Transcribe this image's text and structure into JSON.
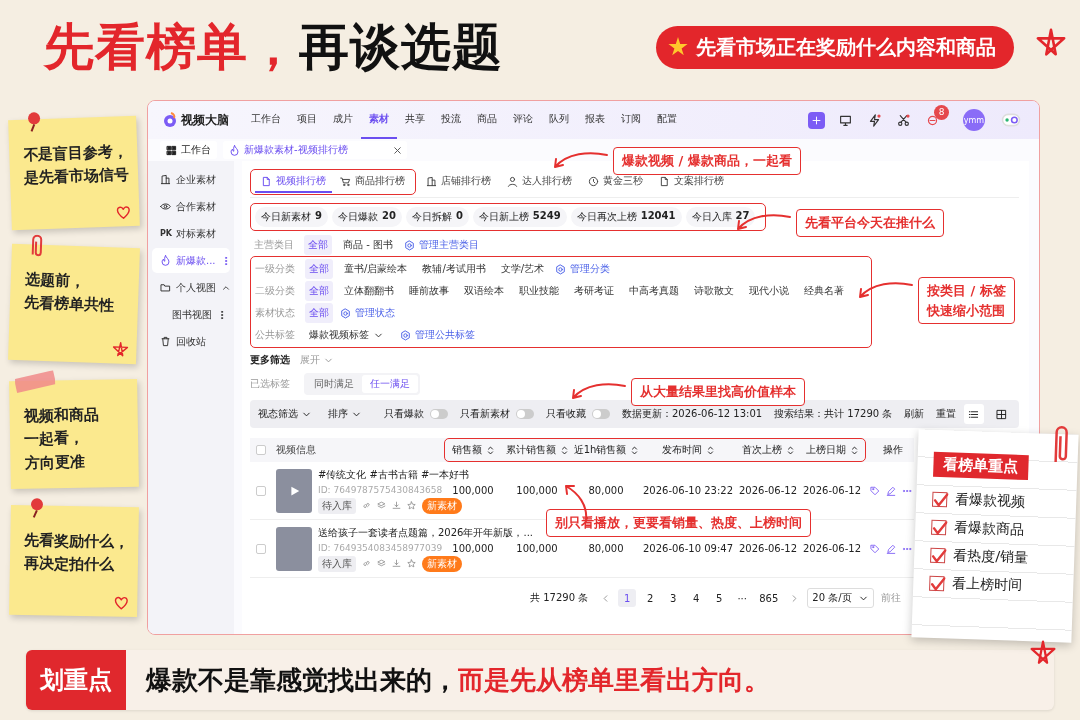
{
  "headline": {
    "parts": [
      {
        "text": "先看榜单，",
        "emphasis": true
      },
      {
        "text": "再谈选题",
        "emphasis": false
      }
    ],
    "tagline": "先看市场正在奖励什么内容和商品"
  },
  "notes": [
    {
      "lines": [
        "不是盲目参考，",
        "是先看市场信号"
      ]
    },
    {
      "lines": [
        "选题前，",
        "先看榜单共性"
      ]
    },
    {
      "lines": [
        "视频和商品",
        "一起看，",
        "方向更准"
      ]
    },
    {
      "lines": [
        "先看奖励什么，",
        "再决定拍什么"
      ]
    }
  ],
  "app": {
    "logo": "视频大脑",
    "nav": [
      {
        "label": "工作台",
        "selected": false
      },
      {
        "label": "项目",
        "selected": false
      },
      {
        "label": "成片",
        "selected": false
      },
      {
        "label": "素材",
        "selected": true
      },
      {
        "label": "共享",
        "selected": false
      },
      {
        "label": "投流",
        "selected": false
      },
      {
        "label": "商品",
        "selected": false
      },
      {
        "label": "评论",
        "selected": false
      },
      {
        "label": "队列",
        "selected": false
      },
      {
        "label": "报表",
        "selected": false
      },
      {
        "label": "订阅",
        "selected": false
      },
      {
        "label": "配置",
        "selected": false
      }
    ],
    "notification_count": "8",
    "avatar": "ymm",
    "breadcrumbs": [
      {
        "label": "工作台",
        "kind": "home"
      },
      {
        "label": "新爆款素材-视频排行榜",
        "kind": "page"
      }
    ],
    "sidebar": [
      {
        "label": "企业素材",
        "selected": false,
        "menu": false
      },
      {
        "label": "合作素材",
        "selected": false,
        "menu": false
      },
      {
        "label": "对标素材",
        "icon_text": "PK",
        "selected": false,
        "menu": false
      },
      {
        "label": "新爆款...",
        "selected": true,
        "menu": true
      },
      {
        "label": "个人视图",
        "selected": false,
        "menu": false,
        "expanded": true,
        "children": [
          {
            "label": "图书视图",
            "selected": false,
            "menu": true
          }
        ]
      },
      {
        "label": "回收站",
        "selected": false,
        "menu": false
      }
    ],
    "tabs_highlighted": true,
    "tabs": [
      {
        "label": "视频排行榜",
        "selected": true
      },
      {
        "label": "商品排行榜",
        "selected": false
      },
      {
        "label": "店铺排行榜",
        "selected": false
      },
      {
        "label": "达人排行榜",
        "selected": false
      },
      {
        "label": "黄金三秒",
        "selected": false
      },
      {
        "label": "文案排行榜",
        "selected": false
      }
    ],
    "stats": {
      "highlighted": true,
      "items": [
        {
          "label": "今日新素材",
          "value": "9"
        },
        {
          "label": "今日爆款",
          "value": "20"
        },
        {
          "label": "今日拆解",
          "value": "0"
        },
        {
          "label": "今日新上榜",
          "value": "5249"
        },
        {
          "label": "今日再次上榜",
          "value": "12041"
        },
        {
          "label": "今日入库",
          "value": "27"
        }
      ]
    },
    "filters_highlighted": true,
    "filters": [
      {
        "label": "主营类目",
        "options": [
          {
            "label": "全部",
            "kind": "chip",
            "selected": true
          },
          {
            "label": "商品 - 图书",
            "kind": "chip",
            "selected": false
          }
        ],
        "manage": "管理主营类目"
      },
      {
        "label": "一级分类",
        "options": [
          {
            "label": "全部",
            "kind": "chip",
            "selected": true
          },
          {
            "label": "童书/启蒙绘本",
            "kind": "chip",
            "selected": false
          },
          {
            "label": "教辅/考试用书",
            "kind": "chip",
            "selected": false
          },
          {
            "label": "文学/艺术",
            "kind": "chip",
            "selected": false
          }
        ],
        "manage": "管理分类"
      },
      {
        "label": "二级分类",
        "options": [
          {
            "label": "全部",
            "kind": "chip",
            "selected": true
          },
          {
            "label": "立体翻翻书",
            "kind": "chip",
            "selected": false
          },
          {
            "label": "睡前故事",
            "kind": "chip",
            "selected": false
          },
          {
            "label": "双语绘本",
            "kind": "chip",
            "selected": false
          },
          {
            "label": "职业技能",
            "kind": "chip",
            "selected": false
          },
          {
            "label": "考研考证",
            "kind": "chip",
            "selected": false
          },
          {
            "label": "中高考真题",
            "kind": "chip",
            "selected": false
          },
          {
            "label": "诗歌散文",
            "kind": "chip",
            "selected": false
          },
          {
            "label": "现代小说",
            "kind": "chip",
            "selected": false
          },
          {
            "label": "经典名著",
            "kind": "chip",
            "selected": false
          }
        ]
      },
      {
        "label": "素材状态",
        "options": [
          {
            "label": "全部",
            "kind": "chip",
            "selected": true
          }
        ],
        "manage": "管理状态"
      },
      {
        "label": "公共标签",
        "options": [
          {
            "label": "爆款视频标签",
            "kind": "dropdown",
            "selected": false
          }
        ],
        "manage": "管理公共标签"
      }
    ],
    "more_filters": {
      "label": "更多筛选",
      "toggle": "展开"
    },
    "selected_tags": {
      "label": "已选标签",
      "modes": [
        {
          "label": "同时满足",
          "selected": false
        },
        {
          "label": "任一满足",
          "selected": true
        }
      ]
    },
    "toolbar": {
      "dropdowns": [
        "视态筛选",
        "排序"
      ],
      "switches": [
        {
          "label": "只看爆款",
          "on": false
        },
        {
          "label": "只看新素材",
          "on": false
        },
        {
          "label": "只看收藏",
          "on": false
        }
      ],
      "updated": "数据更新：2026-06-12 13:01",
      "result": "搜索结果：共计 17290 条",
      "actions": [
        "刷新",
        "重置"
      ],
      "views": [
        {
          "kind": "list",
          "selected": true
        },
        {
          "kind": "grid",
          "selected": false
        }
      ]
    },
    "table": {
      "all_checked": false,
      "sort_columns_highlighted": true,
      "columns": [
        {
          "label": "视频信息",
          "sortable": false
        },
        {
          "label": "销售额",
          "sortable": true
        },
        {
          "label": "累计销售额",
          "sortable": true
        },
        {
          "label": "近1h销售额",
          "sortable": true
        },
        {
          "label": "发布时间",
          "sortable": true
        },
        {
          "label": "首次上榜",
          "sortable": true
        },
        {
          "label": "上榜日期",
          "sortable": true
        },
        {
          "label": "操作",
          "sortable": false
        }
      ],
      "rows": [
        {
          "checked": false,
          "title": "#传统文化 #古书古籍 #一本好书",
          "id": "ID: 7649787575430843658",
          "status": "待入库",
          "badge": "新素材",
          "play_button": true,
          "values": [
            "100,000",
            "100,000",
            "80,000",
            "2026-06-10 23:22",
            "2026-06-12",
            "2026-06-12"
          ]
        },
        {
          "checked": false,
          "title": "送给孩子一套读者点题篇，2026年开年新版，...",
          "id": "ID: 7649354083458977039",
          "status": "待入库",
          "badge": "新素材",
          "play_button": false,
          "values": [
            "100,000",
            "100,000",
            "80,000",
            "2026-06-10 09:47",
            "2026-06-12",
            "2026-06-12"
          ]
        }
      ]
    },
    "pagination": {
      "total": "共 17290 条",
      "pages": [
        {
          "label": "1",
          "selected": true
        },
        {
          "label": "2",
          "selected": false
        },
        {
          "label": "3",
          "selected": false
        },
        {
          "label": "4",
          "selected": false
        },
        {
          "label": "5",
          "selected": false
        },
        {
          "label": "···",
          "selected": false
        },
        {
          "label": "865",
          "selected": false
        }
      ],
      "page_size": "20 条/页",
      "goto": "前往"
    }
  },
  "callouts": [
    {
      "lines": [
        "爆款视频 / 爆款商品，一起看"
      ]
    },
    {
      "lines": [
        "先看平台今天在推什么"
      ]
    },
    {
      "lines": [
        "按类目 / 标签",
        "快速缩小范围"
      ]
    },
    {
      "lines": [
        "从大量结果里找高价值样本"
      ]
    },
    {
      "lines": [
        "别只看播放，更要看销量、热度、上榜时间"
      ]
    }
  ],
  "checklist": {
    "title": "看榜单重点",
    "items": [
      {
        "label": "看爆款视频",
        "checked": true
      },
      {
        "label": "看爆款商品",
        "checked": true
      },
      {
        "label": "看热度/销量",
        "checked": true
      },
      {
        "label": "看上榜时间",
        "checked": true
      }
    ]
  },
  "takeaway": {
    "label": "划重点",
    "parts": [
      {
        "text": "爆款不是靠感觉找出来的，",
        "emphasis": false
      },
      {
        "text": "而是先从榜单里看出方向。",
        "emphasis": true
      }
    ]
  }
}
